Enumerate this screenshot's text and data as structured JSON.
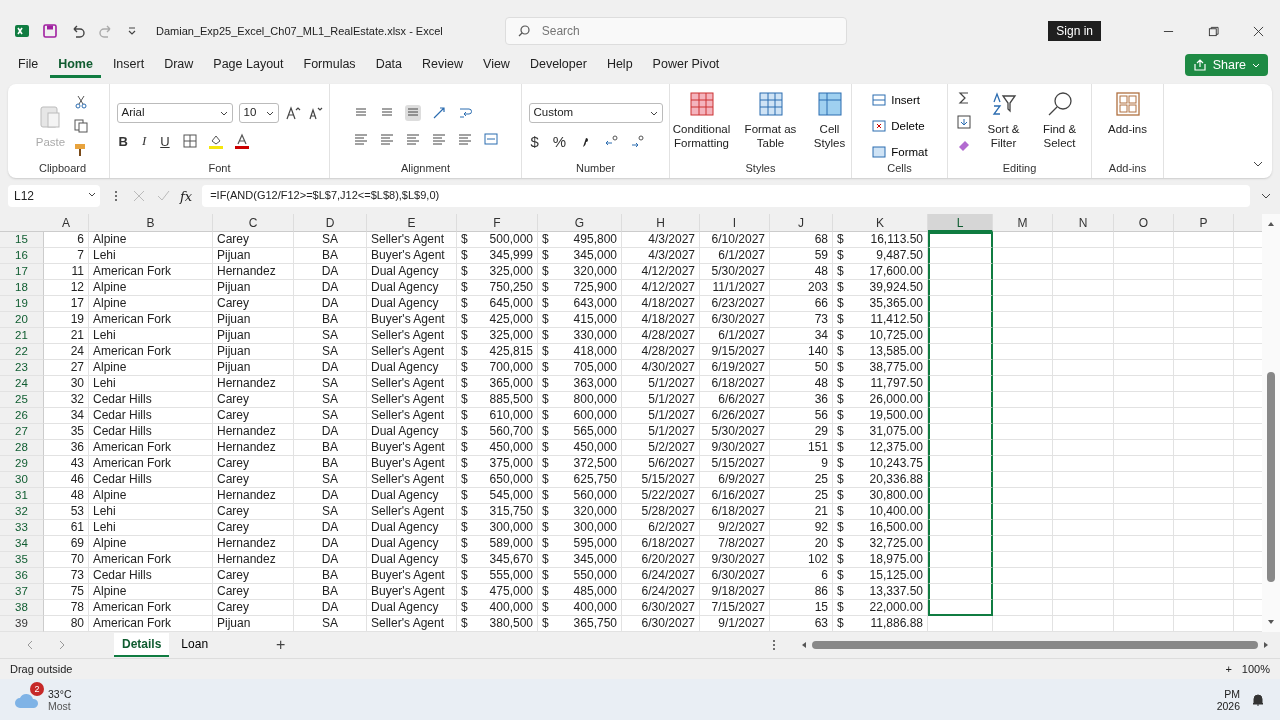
{
  "window": {
    "title": "Damian_Exp25_Excel_Ch07_ML1_RealEstate.xlsx  -  Excel",
    "search_placeholder": "Search",
    "sign_in": "Sign in"
  },
  "menu": [
    {
      "label": "File",
      "selected": false
    },
    {
      "label": "Home",
      "selected": true
    },
    {
      "label": "Insert",
      "selected": false
    },
    {
      "label": "Draw",
      "selected": false
    },
    {
      "label": "Page Layout",
      "selected": false
    },
    {
      "label": "Formulas",
      "selected": false
    },
    {
      "label": "Data",
      "selected": false
    },
    {
      "label": "Review",
      "selected": false
    },
    {
      "label": "View",
      "selected": false
    },
    {
      "label": "Developer",
      "selected": false
    },
    {
      "label": "Help",
      "selected": false
    },
    {
      "label": "Power Pivot",
      "selected": false
    }
  ],
  "share": "Share",
  "ribbon": {
    "clipboard": {
      "label": "Clipboard",
      "paste": "Paste"
    },
    "font": {
      "label": "Font",
      "font_name": "Arial",
      "font_size": "10",
      "bold": "B",
      "italic": "I",
      "underline": "U"
    },
    "alignment": {
      "label": "Alignment"
    },
    "number": {
      "label": "Number",
      "format": "Custom",
      "currency": "$",
      "percent": "%"
    },
    "styles": {
      "label": "Styles",
      "conditional": "Conditional Formatting",
      "format_table": "Format as Table",
      "cell_styles": "Cell Styles"
    },
    "cells": {
      "label": "Cells",
      "insert": "Insert",
      "delete": "Delete",
      "format": "Format"
    },
    "editing": {
      "label": "Editing",
      "sort": "Sort & Filter",
      "find": "Find & Select"
    },
    "addins": {
      "label": "Add-ins",
      "addins": "Add-ins"
    }
  },
  "formula_bar": {
    "name_box": "L12",
    "fx": "fx",
    "formula": "=IF(AND(G12/F12>=$L$7,J12<=$L$8),$L$9,0)"
  },
  "columns": [
    {
      "label": "A",
      "kind": "number",
      "selected": false
    },
    {
      "label": "B",
      "kind": "text",
      "selected": false
    },
    {
      "label": "C",
      "kind": "text",
      "selected": false
    },
    {
      "label": "D",
      "kind": "code",
      "selected": false
    },
    {
      "label": "E",
      "kind": "text",
      "selected": false
    },
    {
      "label": "F",
      "kind": "currency",
      "selected": false
    },
    {
      "label": "G",
      "kind": "currency",
      "selected": false
    },
    {
      "label": "H",
      "kind": "number",
      "selected": false
    },
    {
      "label": "I",
      "kind": "number",
      "selected": false
    },
    {
      "label": "J",
      "kind": "number",
      "selected": false
    },
    {
      "label": "K",
      "kind": "currency",
      "selected": false
    },
    {
      "label": "L",
      "selected": true
    },
    {
      "label": "M",
      "selected": false
    },
    {
      "label": "N",
      "selected": false
    },
    {
      "label": "O",
      "selected": false
    },
    {
      "label": "P",
      "selected": false
    }
  ],
  "rows": [
    {
      "n": "15",
      "selected": true,
      "cells": [
        "6",
        "Alpine",
        "Carey",
        "SA",
        "Seller's Agent",
        {
          "sign": "$",
          "value": "500,000"
        },
        {
          "sign": "$",
          "value": "495,800"
        },
        "4/3/2027",
        "6/10/2027",
        "68",
        {
          "sign": "$",
          "value": "16,113.50"
        }
      ]
    },
    {
      "n": "16",
      "selected": true,
      "cells": [
        "7",
        "Lehi",
        "Pijuan",
        "BA",
        "Buyer's Agent",
        {
          "sign": "$",
          "value": "345,999"
        },
        {
          "sign": "$",
          "value": "345,000"
        },
        "4/3/2027",
        "6/1/2027",
        "59",
        {
          "sign": "$",
          "value": "9,487.50"
        }
      ]
    },
    {
      "n": "17",
      "selected": true,
      "cells": [
        "11",
        "American Fork",
        "Hernandez",
        "DA",
        "Dual Agency",
        {
          "sign": "$",
          "value": "325,000"
        },
        {
          "sign": "$",
          "value": "320,000"
        },
        "4/12/2027",
        "5/30/2027",
        "48",
        {
          "sign": "$",
          "value": "17,600.00"
        }
      ]
    },
    {
      "n": "18",
      "selected": true,
      "cells": [
        "12",
        "Alpine",
        "Pijuan",
        "DA",
        "Dual Agency",
        {
          "sign": "$",
          "value": "750,250"
        },
        {
          "sign": "$",
          "value": "725,900"
        },
        "4/12/2027",
        "11/1/2027",
        "203",
        {
          "sign": "$",
          "value": "39,924.50"
        }
      ]
    },
    {
      "n": "19",
      "selected": true,
      "cells": [
        "17",
        "Alpine",
        "Carey",
        "DA",
        "Dual Agency",
        {
          "sign": "$",
          "value": "645,000"
        },
        {
          "sign": "$",
          "value": "643,000"
        },
        "4/18/2027",
        "6/23/2027",
        "66",
        {
          "sign": "$",
          "value": "35,365.00"
        }
      ]
    },
    {
      "n": "20",
      "selected": true,
      "cells": [
        "19",
        "American Fork",
        "Pijuan",
        "BA",
        "Buyer's Agent",
        {
          "sign": "$",
          "value": "425,000"
        },
        {
          "sign": "$",
          "value": "415,000"
        },
        "4/18/2027",
        "6/30/2027",
        "73",
        {
          "sign": "$",
          "value": "11,412.50"
        }
      ]
    },
    {
      "n": "21",
      "selected": true,
      "cells": [
        "21",
        "Lehi",
        "Pijuan",
        "SA",
        "Seller's Agent",
        {
          "sign": "$",
          "value": "325,000"
        },
        {
          "sign": "$",
          "value": "330,000"
        },
        "4/28/2027",
        "6/1/2027",
        "34",
        {
          "sign": "$",
          "value": "10,725.00"
        }
      ]
    },
    {
      "n": "22",
      "selected": true,
      "cells": [
        "24",
        "American Fork",
        "Pijuan",
        "SA",
        "Seller's Agent",
        {
          "sign": "$",
          "value": "425,815"
        },
        {
          "sign": "$",
          "value": "418,000"
        },
        "4/28/2027",
        "9/15/2027",
        "140",
        {
          "sign": "$",
          "value": "13,585.00"
        }
      ]
    },
    {
      "n": "23",
      "selected": true,
      "cells": [
        "27",
        "Alpine",
        "Pijuan",
        "DA",
        "Dual Agency",
        {
          "sign": "$",
          "value": "700,000"
        },
        {
          "sign": "$",
          "value": "705,000"
        },
        "4/30/2027",
        "6/19/2027",
        "50",
        {
          "sign": "$",
          "value": "38,775.00"
        }
      ]
    },
    {
      "n": "24",
      "selected": true,
      "cells": [
        "30",
        "Lehi",
        "Hernandez",
        "SA",
        "Seller's Agent",
        {
          "sign": "$",
          "value": "365,000"
        },
        {
          "sign": "$",
          "value": "363,000"
        },
        "5/1/2027",
        "6/18/2027",
        "48",
        {
          "sign": "$",
          "value": "11,797.50"
        }
      ]
    },
    {
      "n": "25",
      "selected": true,
      "cells": [
        "32",
        "Cedar Hills",
        "Carey",
        "SA",
        "Seller's Agent",
        {
          "sign": "$",
          "value": "885,500"
        },
        {
          "sign": "$",
          "value": "800,000"
        },
        "5/1/2027",
        "6/6/2027",
        "36",
        {
          "sign": "$",
          "value": "26,000.00"
        }
      ]
    },
    {
      "n": "26",
      "selected": true,
      "cells": [
        "34",
        "Cedar Hills",
        "Carey",
        "SA",
        "Seller's Agent",
        {
          "sign": "$",
          "value": "610,000"
        },
        {
          "sign": "$",
          "value": "600,000"
        },
        "5/1/2027",
        "6/26/2027",
        "56",
        {
          "sign": "$",
          "value": "19,500.00"
        }
      ]
    },
    {
      "n": "27",
      "selected": true,
      "cells": [
        "35",
        "Cedar Hills",
        "Hernandez",
        "DA",
        "Dual Agency",
        {
          "sign": "$",
          "value": "560,700"
        },
        {
          "sign": "$",
          "value": "565,000"
        },
        "5/1/2027",
        "5/30/2027",
        "29",
        {
          "sign": "$",
          "value": "31,075.00"
        }
      ]
    },
    {
      "n": "28",
      "selected": true,
      "cells": [
        "36",
        "American Fork",
        "Hernandez",
        "BA",
        "Buyer's Agent",
        {
          "sign": "$",
          "value": "450,000"
        },
        {
          "sign": "$",
          "value": "450,000"
        },
        "5/2/2027",
        "9/30/2027",
        "151",
        {
          "sign": "$",
          "value": "12,375.00"
        }
      ]
    },
    {
      "n": "29",
      "selected": true,
      "cells": [
        "43",
        "American Fork",
        "Carey",
        "BA",
        "Buyer's Agent",
        {
          "sign": "$",
          "value": "375,000"
        },
        {
          "sign": "$",
          "value": "372,500"
        },
        "5/6/2027",
        "5/15/2027",
        "9",
        {
          "sign": "$",
          "value": "10,243.75"
        }
      ]
    },
    {
      "n": "30",
      "selected": true,
      "cells": [
        "46",
        "Cedar Hills",
        "Carey",
        "SA",
        "Seller's Agent",
        {
          "sign": "$",
          "value": "650,000"
        },
        {
          "sign": "$",
          "value": "625,750"
        },
        "5/15/2027",
        "6/9/2027",
        "25",
        {
          "sign": "$",
          "value": "20,336.88"
        }
      ]
    },
    {
      "n": "31",
      "selected": true,
      "cells": [
        "48",
        "Alpine",
        "Hernandez",
        "DA",
        "Dual Agency",
        {
          "sign": "$",
          "value": "545,000"
        },
        {
          "sign": "$",
          "value": "560,000"
        },
        "5/22/2027",
        "6/16/2027",
        "25",
        {
          "sign": "$",
          "value": "30,800.00"
        }
      ]
    },
    {
      "n": "32",
      "selected": true,
      "cells": [
        "53",
        "Lehi",
        "Carey",
        "SA",
        "Seller's Agent",
        {
          "sign": "$",
          "value": "315,750"
        },
        {
          "sign": "$",
          "value": "320,000"
        },
        "5/28/2027",
        "6/18/2027",
        "21",
        {
          "sign": "$",
          "value": "10,400.00"
        }
      ]
    },
    {
      "n": "33",
      "selected": true,
      "cells": [
        "61",
        "Lehi",
        "Carey",
        "DA",
        "Dual Agency",
        {
          "sign": "$",
          "value": "300,000"
        },
        {
          "sign": "$",
          "value": "300,000"
        },
        "6/2/2027",
        "9/2/2027",
        "92",
        {
          "sign": "$",
          "value": "16,500.00"
        }
      ]
    },
    {
      "n": "34",
      "selected": true,
      "cells": [
        "69",
        "Alpine",
        "Hernandez",
        "DA",
        "Dual Agency",
        {
          "sign": "$",
          "value": "589,000"
        },
        {
          "sign": "$",
          "value": "595,000"
        },
        "6/18/2027",
        "7/8/2027",
        "20",
        {
          "sign": "$",
          "value": "32,725.00"
        }
      ]
    },
    {
      "n": "35",
      "selected": true,
      "cells": [
        "70",
        "American Fork",
        "Hernandez",
        "DA",
        "Dual Agency",
        {
          "sign": "$",
          "value": "345,670"
        },
        {
          "sign": "$",
          "value": "345,000"
        },
        "6/20/2027",
        "9/30/2027",
        "102",
        {
          "sign": "$",
          "value": "18,975.00"
        }
      ]
    },
    {
      "n": "36",
      "selected": true,
      "cells": [
        "73",
        "Cedar Hills",
        "Carey",
        "BA",
        "Buyer's Agent",
        {
          "sign": "$",
          "value": "555,000"
        },
        {
          "sign": "$",
          "value": "550,000"
        },
        "6/24/2027",
        "6/30/2027",
        "6",
        {
          "sign": "$",
          "value": "15,125.00"
        }
      ]
    },
    {
      "n": "37",
      "selected": true,
      "cells": [
        "75",
        "Alpine",
        "Carey",
        "BA",
        "Buyer's Agent",
        {
          "sign": "$",
          "value": "475,000"
        },
        {
          "sign": "$",
          "value": "485,000"
        },
        "6/24/2027",
        "9/18/2027",
        "86",
        {
          "sign": "$",
          "value": "13,337.50"
        }
      ]
    },
    {
      "n": "38",
      "selected": true,
      "cells": [
        "78",
        "American Fork",
        "Carey",
        "DA",
        "Dual Agency",
        {
          "sign": "$",
          "value": "400,000"
        },
        {
          "sign": "$",
          "value": "400,000"
        },
        "6/30/2027",
        "7/15/2027",
        "15",
        {
          "sign": "$",
          "value": "22,000.00"
        }
      ]
    },
    {
      "n": "39",
      "selected": false,
      "cells": [
        "80",
        "American Fork",
        "Pijuan",
        "SA",
        "Seller's Agent",
        {
          "sign": "$",
          "value": "380,500"
        },
        {
          "sign": "$",
          "value": "365,750"
        },
        "6/30/2027",
        "9/1/2027",
        "63",
        {
          "sign": "$",
          "value": "11,886.88"
        }
      ]
    }
  ],
  "sheets": [
    {
      "label": "Details",
      "selected": true
    },
    {
      "label": "Loan",
      "selected": false
    }
  ],
  "add_sheet": "+",
  "status_bar": {
    "message": "Drag outside",
    "zoom_in": "+",
    "zoom": "100%"
  },
  "taskbar": {
    "weather_badge": "2",
    "temperature": "33°C",
    "weather_text": "Most",
    "time": "PM",
    "date": "2026"
  }
}
